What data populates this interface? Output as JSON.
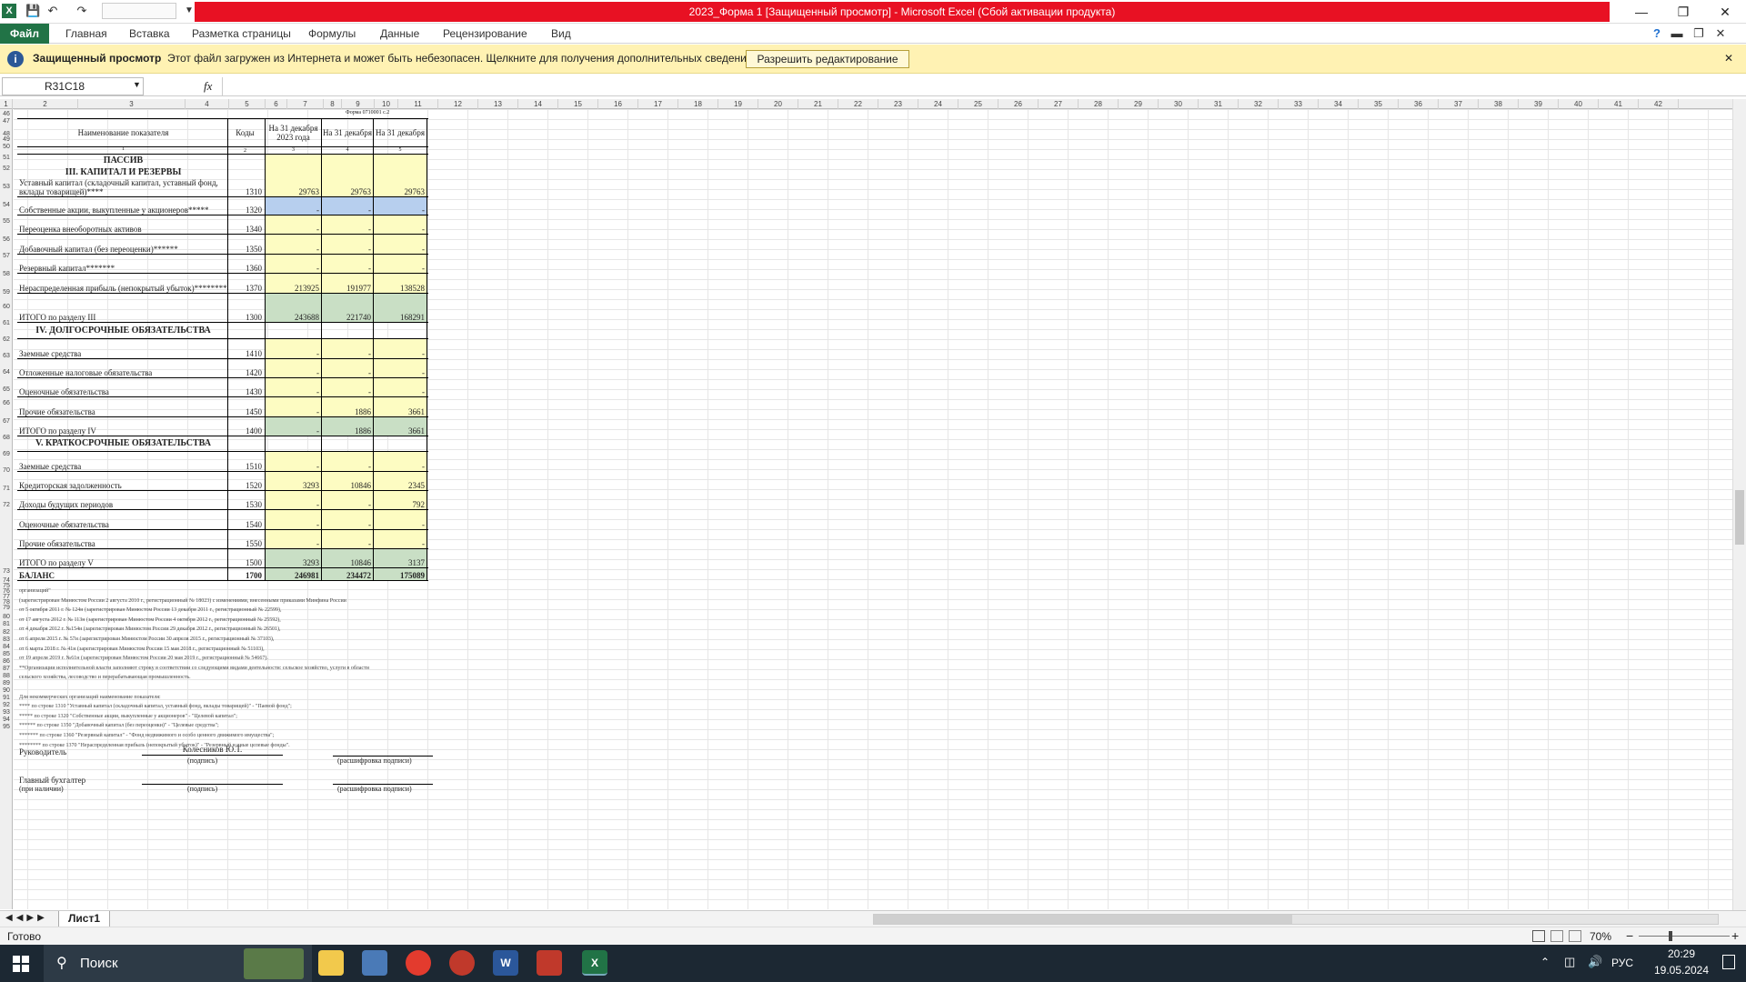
{
  "window": {
    "title": "2023_Форма 1  [Защищенный просмотр] - Microsoft Excel (Сбой активации продукта)",
    "minimize": "—",
    "restore": "❐",
    "close": "✕"
  },
  "ribbon": {
    "file": "Файл",
    "tabs": [
      "Главная",
      "Вставка",
      "Разметка страницы",
      "Формулы",
      "Данные",
      "Рецензирование",
      "Вид"
    ]
  },
  "protected_view": {
    "title": "Защищенный просмотр",
    "message": "Этот файл загружен из Интернета и может быть небезопасен. Щелкните для получения дополнительных сведений.",
    "button": "Разрешить редактирование",
    "close": "✕"
  },
  "formula_bar": {
    "name_box": "R31C18",
    "fx": "fx",
    "formula": ""
  },
  "column_headers": [
    "1",
    "2",
    "3",
    "4",
    "5",
    "6",
    "7",
    "8",
    "9",
    "10",
    "11",
    "12",
    "13",
    "14",
    "15",
    "16",
    "17",
    "18",
    "19",
    "20",
    "21",
    "22",
    "23",
    "24",
    "25",
    "26",
    "27",
    "28",
    "29",
    "30",
    "31",
    "32",
    "33",
    "34",
    "35",
    "36",
    "37",
    "38",
    "39",
    "40",
    "41",
    "42"
  ],
  "row_headers": [
    "46",
    "47",
    "48",
    "49",
    "50",
    "51",
    "52",
    "53",
    "54",
    "55",
    "56",
    "57",
    "58",
    "59",
    "60",
    "61",
    "62",
    "63",
    "64",
    "65",
    "66",
    "67",
    "68",
    "69",
    "70",
    "71",
    "72",
    "73",
    "74",
    "75",
    "76",
    "77",
    "78",
    "79",
    "80",
    "81",
    "82",
    "83",
    "84",
    "85",
    "86",
    "87",
    "88",
    "89",
    "90",
    "91",
    "92",
    "93",
    "94",
    "95"
  ],
  "form": {
    "form_ref": "Форма 0710001 с.2",
    "headers": {
      "name": "Наименование показателя",
      "code": "Коды",
      "c1": "На 31 декабря 2023 года",
      "c2": "На 31 декабря",
      "c3": "На 31 декабря"
    },
    "index": [
      "1",
      "2",
      "3",
      "4",
      "5"
    ],
    "passiv": "ПАССИВ",
    "sec3": "III. КАПИТАЛ И РЕЗЕРВЫ",
    "sec4": "IV. ДОЛГОСРОЧНЫЕ ОБЯЗАТЕЛЬСТВА",
    "sec5": "V. КРАТКОСРОЧНЫЕ ОБЯЗАТЕЛЬСТВА",
    "rows": [
      {
        "name": "Уставный капитал (складочный капитал, уставный фонд, вклады товарищей)****",
        "code": "1310",
        "v1": "29763",
        "v2": "29763",
        "v3": "29763"
      },
      {
        "name": "Собственные акции, выкупленные у акционеров*****",
        "code": "1320",
        "v1": "-",
        "v2": "-",
        "v3": "-"
      },
      {
        "name": "Переоценка внеоборотных активов",
        "code": "1340",
        "v1": "-",
        "v2": "-",
        "v3": "-"
      },
      {
        "name": "Добавочный капитал (без переоценки)******",
        "code": "1350",
        "v1": "-",
        "v2": "-",
        "v3": "-"
      },
      {
        "name": "Резервный капитал*******",
        "code": "1360",
        "v1": "-",
        "v2": "-",
        "v3": "-"
      },
      {
        "name": "Нераспределенная прибыль (непокрытый убыток)********",
        "code": "1370",
        "v1": "213925",
        "v2": "191977",
        "v3": "138528"
      },
      {
        "name": "ИТОГО по разделу III",
        "code": "1300",
        "v1": "243688",
        "v2": "221740",
        "v3": "168291"
      },
      {
        "name": "Заемные средства",
        "code": "1410",
        "v1": "-",
        "v2": "-",
        "v3": "-"
      },
      {
        "name": "Отложенные налоговые обязательства",
        "code": "1420",
        "v1": "-",
        "v2": "-",
        "v3": "-"
      },
      {
        "name": "Оценочные обязательства",
        "code": "1430",
        "v1": "-",
        "v2": "-",
        "v3": "-"
      },
      {
        "name": "Прочие обязательства",
        "code": "1450",
        "v1": "-",
        "v2": "1886",
        "v3": "3661"
      },
      {
        "name": "ИТОГО по разделу IV",
        "code": "1400",
        "v1": "-",
        "v2": "1886",
        "v3": "3661"
      },
      {
        "name": "Заемные средства",
        "code": "1510",
        "v1": "-",
        "v2": "-",
        "v3": "-"
      },
      {
        "name": "Кредиторская задолженность",
        "code": "1520",
        "v1": "3293",
        "v2": "10846",
        "v3": "2345"
      },
      {
        "name": "Доходы будущих периодов",
        "code": "1530",
        "v1": "-",
        "v2": "-",
        "v3": "792"
      },
      {
        "name": "Оценочные обязательства",
        "code": "1540",
        "v1": "-",
        "v2": "-",
        "v3": "-"
      },
      {
        "name": "Прочие обязательства",
        "code": "1550",
        "v1": "-",
        "v2": "-",
        "v3": "-"
      },
      {
        "name": "ИТОГО по разделу V",
        "code": "1500",
        "v1": "3293",
        "v2": "10846",
        "v3": "3137"
      },
      {
        "name": "БАЛАНС",
        "code": "1700",
        "v1": "246981",
        "v2": "234472",
        "v3": "175089"
      }
    ],
    "notes": [
      "организаций\"",
      "(зарегистрирован Минюстом России 2 августа 2010 г., регистрационный № 18023) с изменениями, внесенными приказами Минфина России",
      "от 5 октября 2011 г. № 124н (зарегистрирован Минюстом России 13 декабря 2011 г., регистрационный № 22599),",
      "от 17 августа 2012 г. № 113н (зарегистрирован Минюстом России 4 октября 2012 г., регистрационный № 25592),",
      "от 4 декабря 2012 г. №154н (зарегистрирован Минюстом России 29 декабря 2012 г., регистрационный № 26501),",
      "от 6 апреля 2015 г. № 57н (зарегистрирован Минюстом России 30 апреля 2015 г., регистрационный № 37103),",
      "от 6 марта 2018 г. № 41н (зарегистрирован Минюстом России 15 мая 2018 г., регистрационный № 51103),",
      "от 19 апреля 2019 г. №61н (зарегистрирован Минюстом России 20 мая 2019 г., регистрационный № 54667).",
      "**Организации исполнительной власти заполняют строку в соответствии со следующими видами деятельности: сельское хозяйство, услуги в области",
      "сельского хозяйства, лесоводство и перерабатывающая промышленность.",
      "",
      "Для некоммерческих организаций наименование показателя:",
      "****     по строке 1310 \"Уставный капитал (складочный капитал, уставный фонд, вклады товарищей)\" - \"Паевой фонд\";",
      "*****    по строке 1320 \"Собственные акции, выкупленные у акционеров\" - \"Целевой капитал\";",
      "******   по строке 1350 \"Добавочный капитал (без переоценки)\" - \"Целевые средства\";",
      "*******  по строке 1360 \"Резервный капитал\" - \"Фонд недвижимого и особо ценного движимого имущества\";",
      "******** по строке 1370 \"Нераспределенная прибыль (непокрытый убыток)\" - \"Резервный и иные целевые фонды\"."
    ],
    "signature": {
      "head": "Руководитель",
      "head_name": "Колесников Ю.Т.",
      "sign": "(подпись)",
      "decode": "(расшифровка подписи)",
      "accountant": "Главный бухгалтер",
      "if_present": "(при наличии)"
    }
  },
  "sheet_tab": "Лист1",
  "status": {
    "ready": "Готово",
    "zoom": "70%",
    "zoom_out": "−",
    "zoom_in": "+"
  },
  "taskbar": {
    "search": "Поиск",
    "lang": "РУС",
    "time": "20:29",
    "date": "19.05.2024"
  }
}
